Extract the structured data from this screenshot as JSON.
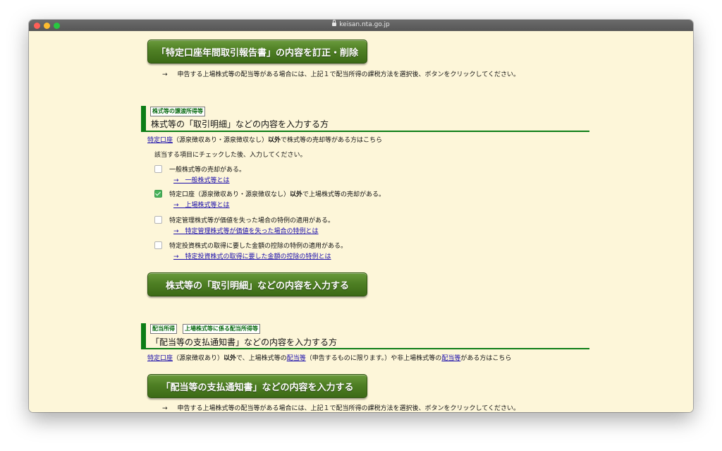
{
  "browser": {
    "url": "keisan.nta.go.jp"
  },
  "top": {
    "edit_button": "「特定口座年間取引報告書」の内容を訂正・削除",
    "note_arrow": "→",
    "note": "申告する上場株式等の配当等がある場合には、上記１で配当所得の課税方法を選択後、ボタンをクリックしてください。"
  },
  "stocks": {
    "badge": "株式等の譲渡所得等",
    "title": "株式等の「取引明細」などの内容を入力する方",
    "intro_link": "特定口座",
    "intro_paren": "（源泉徴収あり・源泉徴収なし）",
    "intro_bold": "以外",
    "intro_rest": "で株式等の売却等がある方はこちら",
    "instruction": "該当する項目にチェックした後、入力してください。",
    "options": [
      {
        "label": "一般株式等の売却がある。",
        "link": "→　一般株式等とは",
        "checked": false
      },
      {
        "label_a": "特定口座（源泉徴収あり・源泉徴収なし）",
        "label_bold": "以外",
        "label_b": "で上場株式等の売却がある。",
        "link": "→　上場株式等とは",
        "checked": true
      },
      {
        "label": "特定管理株式等が価値を失った場合の特例の適用がある。",
        "link": "→　特定管理株式等が価値を失った場合の特例とは",
        "checked": false
      },
      {
        "label": "特定投資株式の取得に要した金額の控除の特例の適用がある。",
        "link": "→　特定投資株式の取得に要した金額の控除の特例とは",
        "checked": false
      }
    ],
    "button": "株式等の「取引明細」などの内容を入力する"
  },
  "dividends": {
    "badge1": "配当所得",
    "badge2": "上場株式等に係る配当所得等",
    "title": "「配当等の支払通知書」などの内容を入力する方",
    "intro_link1": "特定口座",
    "intro_paren": "（源泉徴収あり）",
    "intro_bold": "以外",
    "intro_mid": "で、上場株式等の",
    "intro_link2": "配当等",
    "intro_mid2": "（申告するものに限ります。）や非上場株式等の",
    "intro_link3": "配当等",
    "intro_end": "がある方はこちら",
    "button": "「配当等の支払通知書」などの内容を入力する",
    "note_arrow": "→",
    "note": "申告する上場株式等の配当等がある場合には、上記１で配当所得の課税方法を選択後、ボタンをクリックしてください。"
  }
}
